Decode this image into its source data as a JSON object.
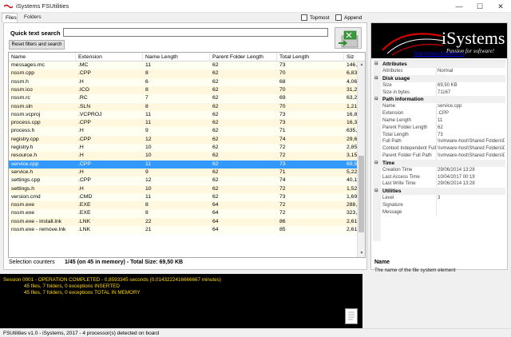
{
  "window": {
    "title": "iSystems FSUtilities",
    "min": "—",
    "max": "☐",
    "close": "✕"
  },
  "tabs": {
    "files": "Files",
    "folders": "Folders"
  },
  "options": {
    "topmost": "Topmost",
    "append": "Append"
  },
  "search": {
    "label": "Quick text search",
    "value": "",
    "reset": "Reset filters and search"
  },
  "grid": {
    "columns": [
      "Name",
      "Extension",
      "Name Length",
      "Parent Folder Length",
      "Total Length",
      "Siz"
    ],
    "selected_index": 14,
    "rows": [
      [
        "messages.mc",
        ".MC",
        "11",
        "62",
        "73",
        "146,"
      ],
      [
        "nssm.cpp",
        ".CPP",
        "8",
        "62",
        "70",
        "6,83"
      ],
      [
        "nssm.h",
        ".H",
        "6",
        "62",
        "68",
        "4,06"
      ],
      [
        "nssm.ico",
        ".ICO",
        "8",
        "62",
        "70",
        "31,2"
      ],
      [
        "nssm.rc",
        ".RC",
        "7",
        "62",
        "69",
        "63,2"
      ],
      [
        "nssm.sln",
        ".SLN",
        "8",
        "62",
        "70",
        "1,21"
      ],
      [
        "nssm.vcproj",
        ".VCPROJ",
        "11",
        "62",
        "73",
        "16,8"
      ],
      [
        "process.cpp",
        ".CPP",
        "11",
        "62",
        "73",
        "16,3"
      ],
      [
        "process.h",
        ".H",
        "9",
        "62",
        "71",
        "635,"
      ],
      [
        "registry.cpp",
        ".CPP",
        "12",
        "62",
        "74",
        "29,6"
      ],
      [
        "registry.h",
        ".H",
        "10",
        "62",
        "72",
        "2,85"
      ],
      [
        "resource.h",
        ".H",
        "10",
        "62",
        "72",
        "3,15"
      ],
      [
        "service.cpp",
        ".CPP",
        "11",
        "62",
        "73",
        "69,5"
      ],
      [
        "service.h",
        ".H",
        "9",
        "62",
        "71",
        "5,22"
      ],
      [
        "settings.cpp",
        ".CPP",
        "12",
        "62",
        "74",
        "40,1"
      ],
      [
        "settings.h",
        ".H",
        "10",
        "62",
        "72",
        "1,52"
      ],
      [
        "version.cmd",
        ".CMD",
        "11",
        "62",
        "73",
        "1,69"
      ],
      [
        "nssm.exe",
        ".EXE",
        "8",
        "64",
        "72",
        "288,"
      ],
      [
        "nssm.exe",
        ".EXE",
        "8",
        "64",
        "72",
        "323,"
      ],
      [
        "nssm.exe - install.lnk",
        ".LNK",
        "22",
        "64",
        "86",
        "2,61"
      ],
      [
        "nssm.exe - remove.lnk",
        ".LNK",
        "21",
        "64",
        "85",
        "2,61"
      ]
    ]
  },
  "counters": {
    "label": "Selection counters",
    "value": "1/45 (on 45 in memory) - Total Size: 69,50 KB"
  },
  "logo": {
    "brand": "iSystems",
    "tagline": "Passion for software!",
    "link": "http://www.iSystems.it"
  },
  "properties": [
    {
      "category": "Attributes",
      "items": [
        [
          "Attributes",
          "Normal"
        ]
      ]
    },
    {
      "category": "Disk usage",
      "items": [
        [
          "Size",
          "69,50 KB"
        ],
        [
          "Size in bytes",
          "71167"
        ]
      ]
    },
    {
      "category": "Path information",
      "items": [
        [
          "Name",
          "service.cpp"
        ],
        [
          "Extension",
          ".CPP"
        ],
        [
          "Name Length",
          "11"
        ],
        [
          "Parent Folder Length",
          "62"
        ],
        [
          "Total Length",
          "73"
        ],
        [
          "Full Path",
          "\\\\vmware-host\\Shared Folders\\D"
        ],
        [
          "Context Independent Full",
          "\\\\vmware-host\\Shared Folders\\D"
        ],
        [
          "Parent Folder Full Path",
          "\\\\vmware-host\\Shared Folders\\D"
        ]
      ]
    },
    {
      "category": "Time",
      "items": [
        [
          "Creation Time",
          "29/06/2014 13:28"
        ],
        [
          "Last Access Time",
          "10/04/2017 00:19"
        ],
        [
          "Last Write Time",
          "29/06/2014 13:28"
        ]
      ]
    },
    {
      "category": "Utilities",
      "items": [
        [
          "Level",
          "3"
        ],
        [
          "Signature",
          ""
        ],
        [
          "Message",
          ""
        ]
      ]
    }
  ],
  "description": {
    "title": "Name",
    "text": "The name of the file system element"
  },
  "console": {
    "lines": [
      "Session 0001 - OPERATION COMPLETED - 0,8593345 seconds (0,0143222416666667 minutes)",
      "45 files, 7 folders, 0 exceptions INSERTED",
      "45 files, 7 folders, 0 exceptions TOTAL IN MEMORY"
    ]
  },
  "status": "FSUtilities v1.0 - iSystems, 2017 - 4 processor(s) detected on board",
  "colors": {
    "selection": "#3399ff",
    "row_odd": "#fffff1",
    "row_even": "#fff8df",
    "console_text": "#ffd800"
  }
}
